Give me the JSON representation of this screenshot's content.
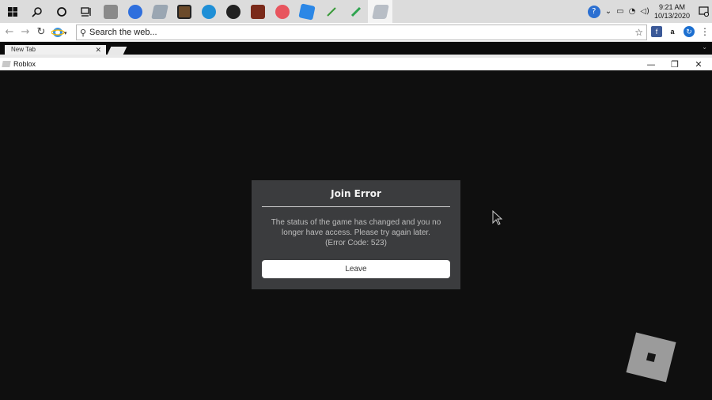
{
  "taskbar": {
    "icons": [
      {
        "name": "windows-start-icon",
        "color": "#1a1a1a"
      },
      {
        "name": "search-icon",
        "color": "#1a1a1a"
      },
      {
        "name": "cortana-icon",
        "color": "#1a1a1a"
      },
      {
        "name": "task-view-icon",
        "color": "#1a1a1a"
      },
      {
        "name": "app-icon-1",
        "color": "#8a8a8a"
      },
      {
        "name": "chrome-icon",
        "color": "#2f6fdd"
      },
      {
        "name": "roblox-studio-icon",
        "color": "#9aa6b2"
      },
      {
        "name": "minecraft-icon",
        "color": "#6b4a2a"
      },
      {
        "name": "edge-icon",
        "color": "#1f8fd6"
      },
      {
        "name": "app-icon-2",
        "color": "#222222"
      },
      {
        "name": "app-icon-3",
        "color": "#7a2a1a"
      },
      {
        "name": "firefox-icon",
        "color": "#e8555e"
      },
      {
        "name": "app-icon-4",
        "color": "#2b87e6"
      },
      {
        "name": "app-icon-5",
        "color": "#3a9a3a"
      },
      {
        "name": "app-icon-6",
        "color": "#2ea44f"
      },
      {
        "name": "roblox-icon",
        "color": "#b8bec6"
      }
    ],
    "clock_time": "9:21 AM",
    "clock_date": "10/13/2020"
  },
  "browser": {
    "search_placeholder": "Search the web...",
    "tab_label": "New Tab",
    "tab_close": "✕"
  },
  "window": {
    "title": "Roblox",
    "minimize": "—",
    "restore": "❐",
    "close": "✕"
  },
  "dialog": {
    "title": "Join Error",
    "message_line1": "The status of the game has changed and you no",
    "message_line2": "longer have access.  Please try again later.",
    "message_line3": "(Error Code: 523)",
    "button_label": "Leave"
  },
  "colors": {
    "dialog_bg": "#3b3c3e",
    "game_bg": "#0f0f0f",
    "button_bg": "#ffffff"
  }
}
